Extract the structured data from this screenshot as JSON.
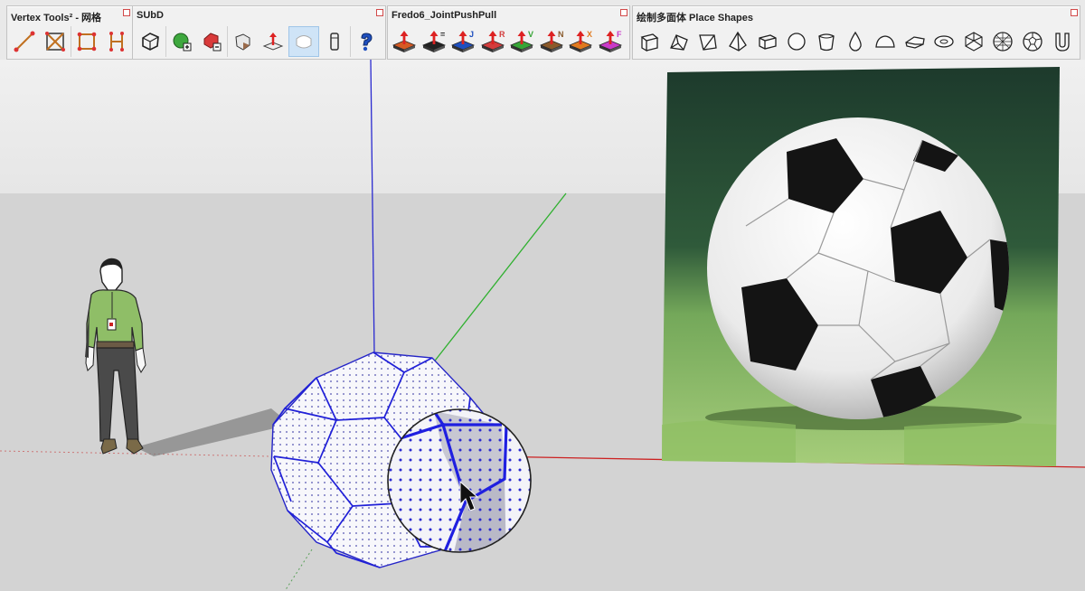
{
  "toolbars": {
    "vertex": {
      "title": "Vertex Tools² - 网格",
      "buttons": [
        "line-tool",
        "select-box",
        "square-frame",
        "vertex-grid"
      ]
    },
    "subd": {
      "title": "SUbD",
      "buttons": [
        "subdivide-cube",
        "add-green-sphere",
        "remove-red-sphere",
        "crease",
        "push-normal",
        "smooth-shade",
        "pillar",
        "help"
      ]
    },
    "fredo": {
      "title": "Fredo6_JointPushPull",
      "buttons": [
        {
          "name": "joint-push-pull",
          "letter": "",
          "color": "#d55a23"
        },
        {
          "name": "joint-push-pull-equal",
          "letter": "=",
          "color": "#222222"
        },
        {
          "name": "joint-push-pull-j",
          "letter": "J",
          "color": "#1e4fbf"
        },
        {
          "name": "joint-push-pull-r",
          "letter": "R",
          "color": "#d33d3d"
        },
        {
          "name": "joint-push-pull-v",
          "letter": "V",
          "color": "#37a537"
        },
        {
          "name": "joint-push-pull-n",
          "letter": "N",
          "color": "#8a5a2b"
        },
        {
          "name": "joint-push-pull-x",
          "letter": "X",
          "color": "#e07a1f"
        },
        {
          "name": "joint-push-pull-f",
          "letter": "F",
          "color": "#c93bc9"
        }
      ]
    },
    "shapes": {
      "title": "绘制多面体 Place Shapes",
      "buttons": [
        "box-shape",
        "wedge-shape",
        "prism-shape",
        "pyramid-shape",
        "slab-shape",
        "circle-shape",
        "cylinder-shape",
        "drop-shape",
        "dome-shape",
        "lens-shape",
        "torus-shape",
        "geodesic-shape",
        "sphere-shape",
        "soccer-shape",
        "u-shape"
      ]
    }
  },
  "colors": {
    "axis_blue": "#2a2ad0",
    "axis_green": "#2fb02f",
    "axis_red": "#cc2020",
    "edge_blue": "#1f1fe0"
  }
}
